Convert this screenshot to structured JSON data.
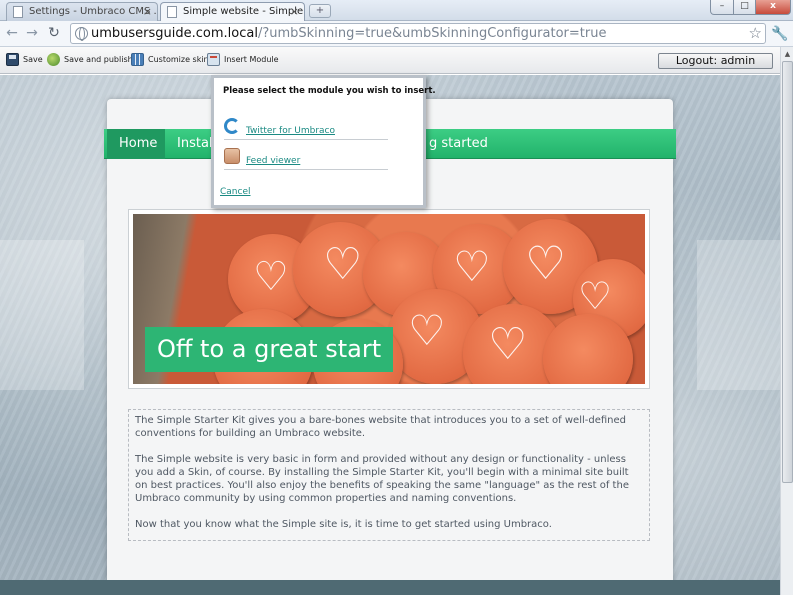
{
  "browser": {
    "tabs": [
      {
        "title": "Settings - Umbraco CMS ..."
      },
      {
        "title": "Simple website - Simple ..."
      }
    ],
    "tab_close_glyph": "×",
    "new_tab_glyph": "+",
    "window_controls": {
      "minimize": "–",
      "maximize": "□",
      "close": "x"
    },
    "url_host": "umbusersguide.com.local",
    "url_rest": "/?umbSkinning=true&umbSkinningConfigurator=true",
    "icons": [
      "back-icon",
      "forward-icon",
      "reload-icon",
      "globe-icon",
      "star-icon",
      "wrench-icon"
    ]
  },
  "umbraco_toolbar": {
    "save_label": "Save",
    "publish_label": "Save and publish",
    "customize_label": "Customize skin",
    "insert_module_label": "Insert Module",
    "logout_label": "Logout: admin"
  },
  "site": {
    "nav": {
      "home": "Home",
      "install": "Instal",
      "started": "g started"
    },
    "banner_caption": "Off to a great start",
    "paragraphs": [
      "The Simple Starter Kit gives you a bare-bones website that introduces you to a set of well-defined conventions for building an Umbraco website.",
      "The Simple website is very basic in form and provided without any design or functionality - unless you add a Skin, of course. By installing the Simple Starter Kit, you'll begin with a minimal site built on best practices. You'll also enjoy the benefits of speaking the same \"language\" as the rest of the Umbraco community by using common properties and naming conventions.",
      "Now that you know what the Simple site is, it is time to get started using Umbraco."
    ]
  },
  "insert_module_dialog": {
    "prompt": "Please select the module you wish to insert.",
    "modules": [
      {
        "label": "Twitter for Umbraco",
        "icon": "twitter-icon"
      },
      {
        "label": "Feed viewer",
        "icon": "feed-icon"
      }
    ],
    "cancel_label": "Cancel"
  },
  "colors": {
    "nav_green": "#2db574",
    "link_teal": "#1a8a83",
    "canvas_blue_gray": "#a7b6c1"
  }
}
